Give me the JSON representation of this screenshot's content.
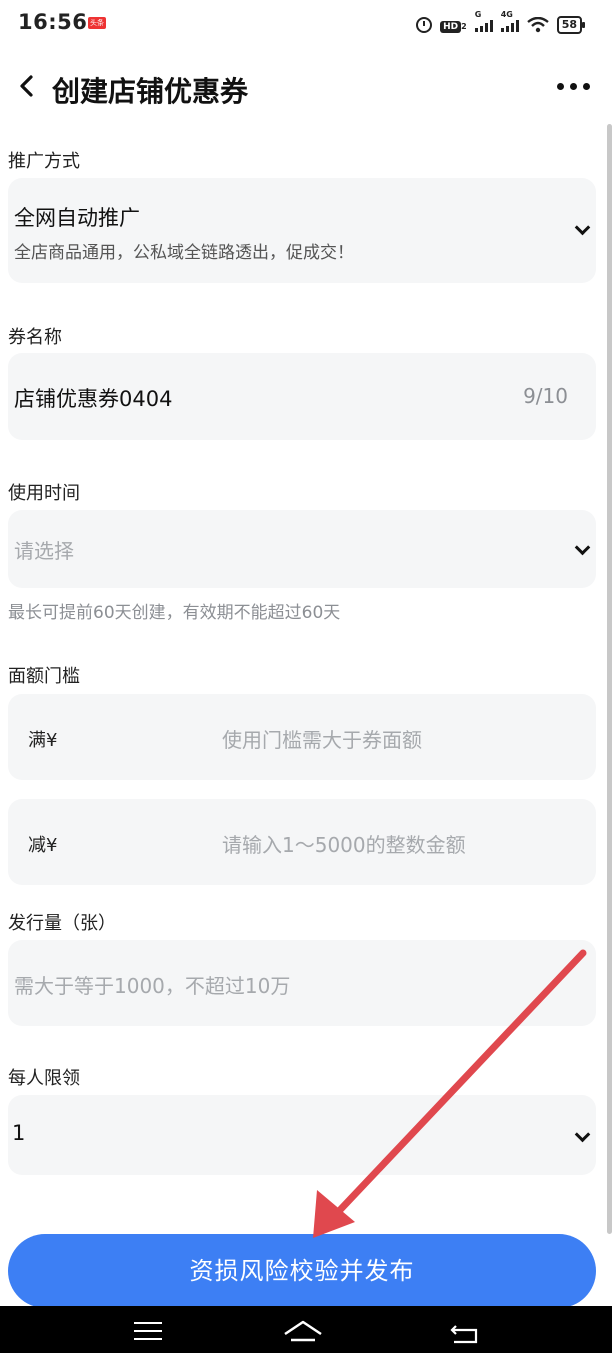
{
  "status_bar": {
    "time": "16:56",
    "badge": "头条",
    "hd": "HD",
    "hd_sub": "2",
    "signal1_label": "G",
    "signal2_label": "4G",
    "battery": "58"
  },
  "header": {
    "title": "创建店铺优惠券"
  },
  "promotion": {
    "label": "推广方式",
    "value": "全网自动推广",
    "description": "全店商品通用，公私域全链路透出，促成交！"
  },
  "coupon_name": {
    "label": "券名称",
    "value": "店铺优惠券0404",
    "counter": "9/10"
  },
  "usage_time": {
    "label": "使用时间",
    "placeholder": "请选择",
    "hint": "最长可提前60天创建，有效期不能超过60天"
  },
  "threshold": {
    "label": "面额门槛",
    "full_prefix": "满¥",
    "full_placeholder": "使用门槛需大于券面额",
    "minus_prefix": "减¥",
    "minus_placeholder": "请输入1～5000的整数金额"
  },
  "quantity": {
    "label": "发行量（张）",
    "placeholder": "需大于等于1000，不超过10万"
  },
  "per_person_limit": {
    "label": "每人限领",
    "value": "1"
  },
  "publish_button": "资损风险校验并发布",
  "colors": {
    "primary": "#3d7ff4",
    "field_bg": "#f5f6f7",
    "placeholder": "#a6a9ad",
    "annotation_arrow": "#e0484e"
  }
}
